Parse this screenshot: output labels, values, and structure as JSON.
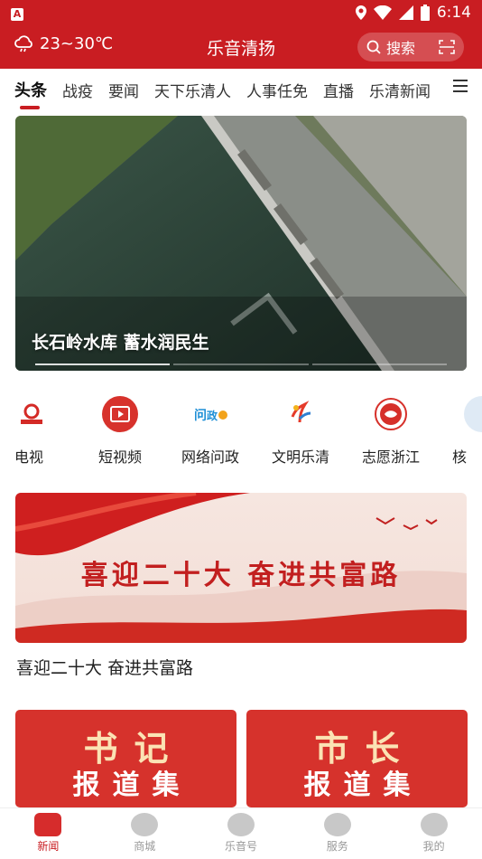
{
  "status_bar": {
    "time": "6:14"
  },
  "header": {
    "weather": "23~30℃",
    "title": "乐音清扬",
    "search_label": "搜索"
  },
  "tabs": [
    {
      "label": "头条",
      "active": true
    },
    {
      "label": "战疫"
    },
    {
      "label": "要闻"
    },
    {
      "label": "天下乐清人"
    },
    {
      "label": "人事任免"
    },
    {
      "label": "直播"
    },
    {
      "label": "乐清新闻"
    }
  ],
  "hero": {
    "caption": "长石岭水库 蓄水润民生"
  },
  "services": [
    {
      "label": "电视",
      "icon": "tv-icon"
    },
    {
      "label": "短视频",
      "icon": "short-video-icon"
    },
    {
      "label": "网络问政",
      "icon": "wenzheng-icon"
    },
    {
      "label": "文明乐清",
      "icon": "civilization-icon"
    },
    {
      "label": "志愿浙江",
      "icon": "volunteer-icon"
    },
    {
      "label": "核",
      "icon": "more-icon"
    }
  ],
  "banner": {
    "title_art": "喜迎二十大 奋进共富路",
    "caption": "喜迎二十大 奋进共富路"
  },
  "cards": [
    {
      "title": "书记",
      "subtitle": "报道集"
    },
    {
      "title": "市长",
      "subtitle": "报道集"
    }
  ],
  "bottom_nav": [
    {
      "label": "新闻",
      "active": true
    },
    {
      "label": "商城"
    },
    {
      "label": "乐音号"
    },
    {
      "label": "服务"
    },
    {
      "label": "我的"
    }
  ],
  "colors": {
    "brand_red": "#c91d22"
  }
}
